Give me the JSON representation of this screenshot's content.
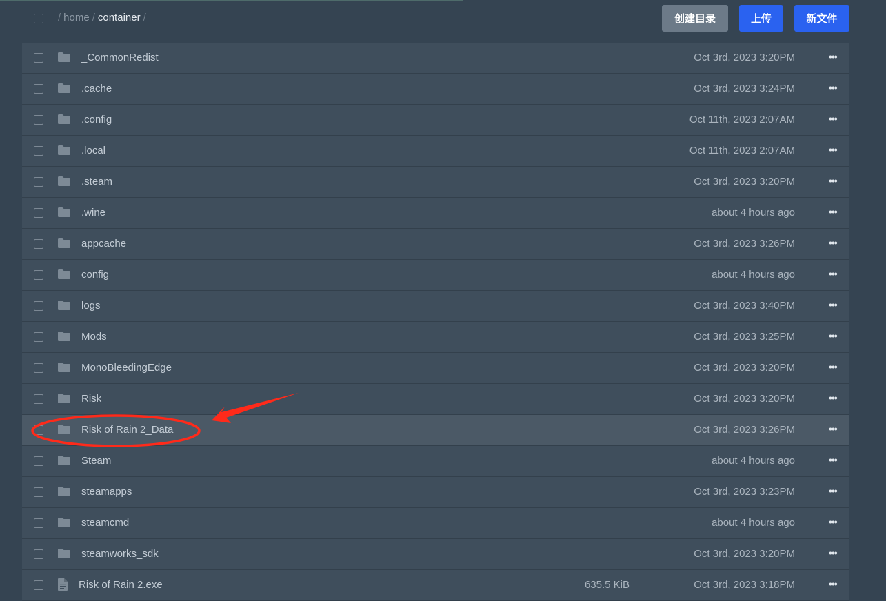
{
  "breadcrumb": {
    "root_sep": "/",
    "parts": [
      "home",
      "container"
    ],
    "trailing_sep": "/"
  },
  "toolbar": {
    "mkdir_label": "创建目录",
    "upload_label": "上传",
    "newfile_label": "新文件"
  },
  "files": [
    {
      "name": "_CommonRedist",
      "type": "folder",
      "size": "",
      "date": "Oct 3rd, 2023 3:20PM"
    },
    {
      "name": ".cache",
      "type": "folder",
      "size": "",
      "date": "Oct 3rd, 2023 3:24PM"
    },
    {
      "name": ".config",
      "type": "folder",
      "size": "",
      "date": "Oct 11th, 2023 2:07AM"
    },
    {
      "name": ".local",
      "type": "folder",
      "size": "",
      "date": "Oct 11th, 2023 2:07AM"
    },
    {
      "name": ".steam",
      "type": "folder",
      "size": "",
      "date": "Oct 3rd, 2023 3:20PM"
    },
    {
      "name": ".wine",
      "type": "folder",
      "size": "",
      "date": "about 4 hours ago"
    },
    {
      "name": "appcache",
      "type": "folder",
      "size": "",
      "date": "Oct 3rd, 2023 3:26PM"
    },
    {
      "name": "config",
      "type": "folder",
      "size": "",
      "date": "about 4 hours ago"
    },
    {
      "name": "logs",
      "type": "folder",
      "size": "",
      "date": "Oct 3rd, 2023 3:40PM"
    },
    {
      "name": "Mods",
      "type": "folder",
      "size": "",
      "date": "Oct 3rd, 2023 3:25PM"
    },
    {
      "name": "MonoBleedingEdge",
      "type": "folder",
      "size": "",
      "date": "Oct 3rd, 2023 3:20PM"
    },
    {
      "name": "Risk",
      "type": "folder",
      "size": "",
      "date": "Oct 3rd, 2023 3:20PM"
    },
    {
      "name": "Risk of Rain 2_Data",
      "type": "folder",
      "size": "",
      "date": "Oct 3rd, 2023 3:26PM",
      "highlighted": true
    },
    {
      "name": "Steam",
      "type": "folder",
      "size": "",
      "date": "about 4 hours ago"
    },
    {
      "name": "steamapps",
      "type": "folder",
      "size": "",
      "date": "Oct 3rd, 2023 3:23PM"
    },
    {
      "name": "steamcmd",
      "type": "folder",
      "size": "",
      "date": "about 4 hours ago"
    },
    {
      "name": "steamworks_sdk",
      "type": "folder",
      "size": "",
      "date": "Oct 3rd, 2023 3:20PM"
    },
    {
      "name": "Risk of Rain 2.exe",
      "type": "file",
      "size": "635.5 KiB",
      "date": "Oct 3rd, 2023 3:18PM"
    }
  ],
  "icons": {
    "folder": "folder-icon",
    "file": "file-icon",
    "more": "more-options-icon"
  },
  "colors": {
    "background": "#354452",
    "row": "#3f4e5c",
    "row_highlight": "#4b5966",
    "primary_button": "#2a62f0",
    "secondary_button": "#6c7a88",
    "annotation": "#ff2a1a"
  }
}
